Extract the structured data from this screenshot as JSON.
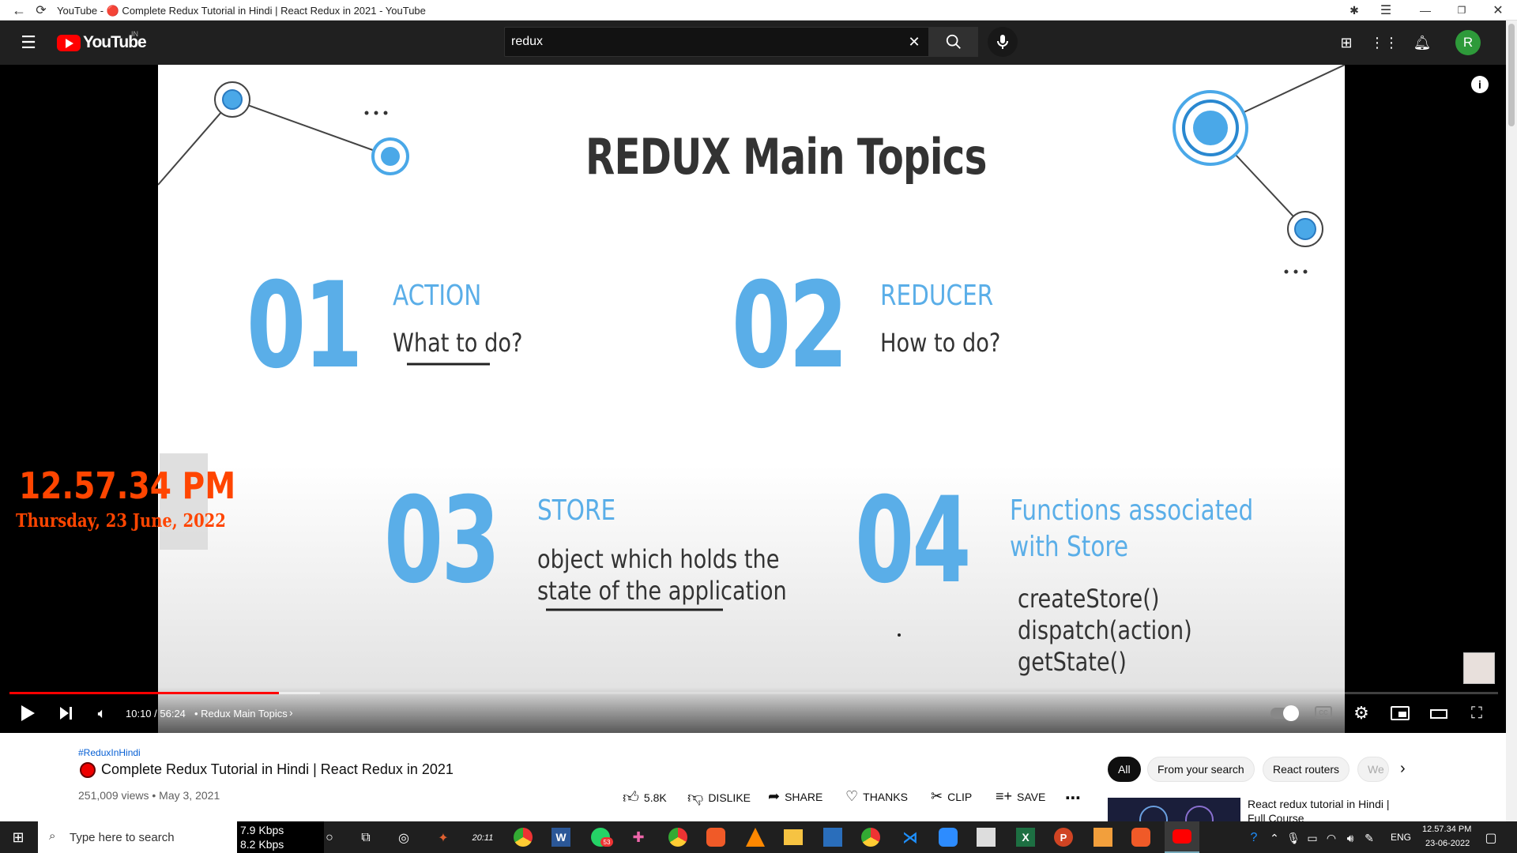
{
  "browser": {
    "tab_title": "YouTube - 🔴 Complete Redux Tutorial in Hindi | React Redux in 2021 - YouTube"
  },
  "youtube": {
    "logo_text": "YouTube",
    "region": "IN",
    "search_value": "redux",
    "avatar_letter": "R"
  },
  "slide": {
    "title": "REDUX Main Topics",
    "items": [
      {
        "num": "01",
        "head": "ACTION",
        "lines": [
          "What to do?"
        ]
      },
      {
        "num": "02",
        "head": "REDUCER",
        "lines": [
          "How to do?"
        ]
      },
      {
        "num": "03",
        "head": "STORE",
        "lines": [
          "object which holds the",
          "state of the application"
        ]
      },
      {
        "num": "04",
        "head_lines": [
          "Functions associated",
          "with Store"
        ],
        "lines": [
          "createStore()",
          "dispatch(action)",
          "getState()"
        ]
      }
    ]
  },
  "overlay_clock": {
    "time": "12.57.34 PM",
    "date": "Thursday, 23 June, 2022"
  },
  "player": {
    "time": "10:10 / 56:24",
    "chapter": "• Redux Main Topics",
    "progress_fraction": 0.181
  },
  "video": {
    "hashtag": "#ReduxInHindi",
    "title": "Complete Redux Tutorial in Hindi | React Redux in 2021",
    "meta": "251,009 views • May 3, 2021",
    "actions": {
      "like": "5.8K",
      "dislike": "DISLIKE",
      "share": "SHARE",
      "thanks": "THANKS",
      "clip": "CLIP",
      "save": "SAVE"
    }
  },
  "chips": [
    "All",
    "From your search",
    "React routers",
    "We"
  ],
  "suggestion": {
    "title_line1": "React redux tutorial in Hindi |",
    "title_line2": "Full Course"
  },
  "taskbar": {
    "search_placeholder": "Type here to search",
    "net_down": "7.9 Kbps",
    "net_up": "8.2 Kbps",
    "lang": "ENG",
    "clock_time": "12.57.34 PM",
    "clock_date": "23-06-2022",
    "whatsapp_badge": "53",
    "app_label": "20:11"
  }
}
